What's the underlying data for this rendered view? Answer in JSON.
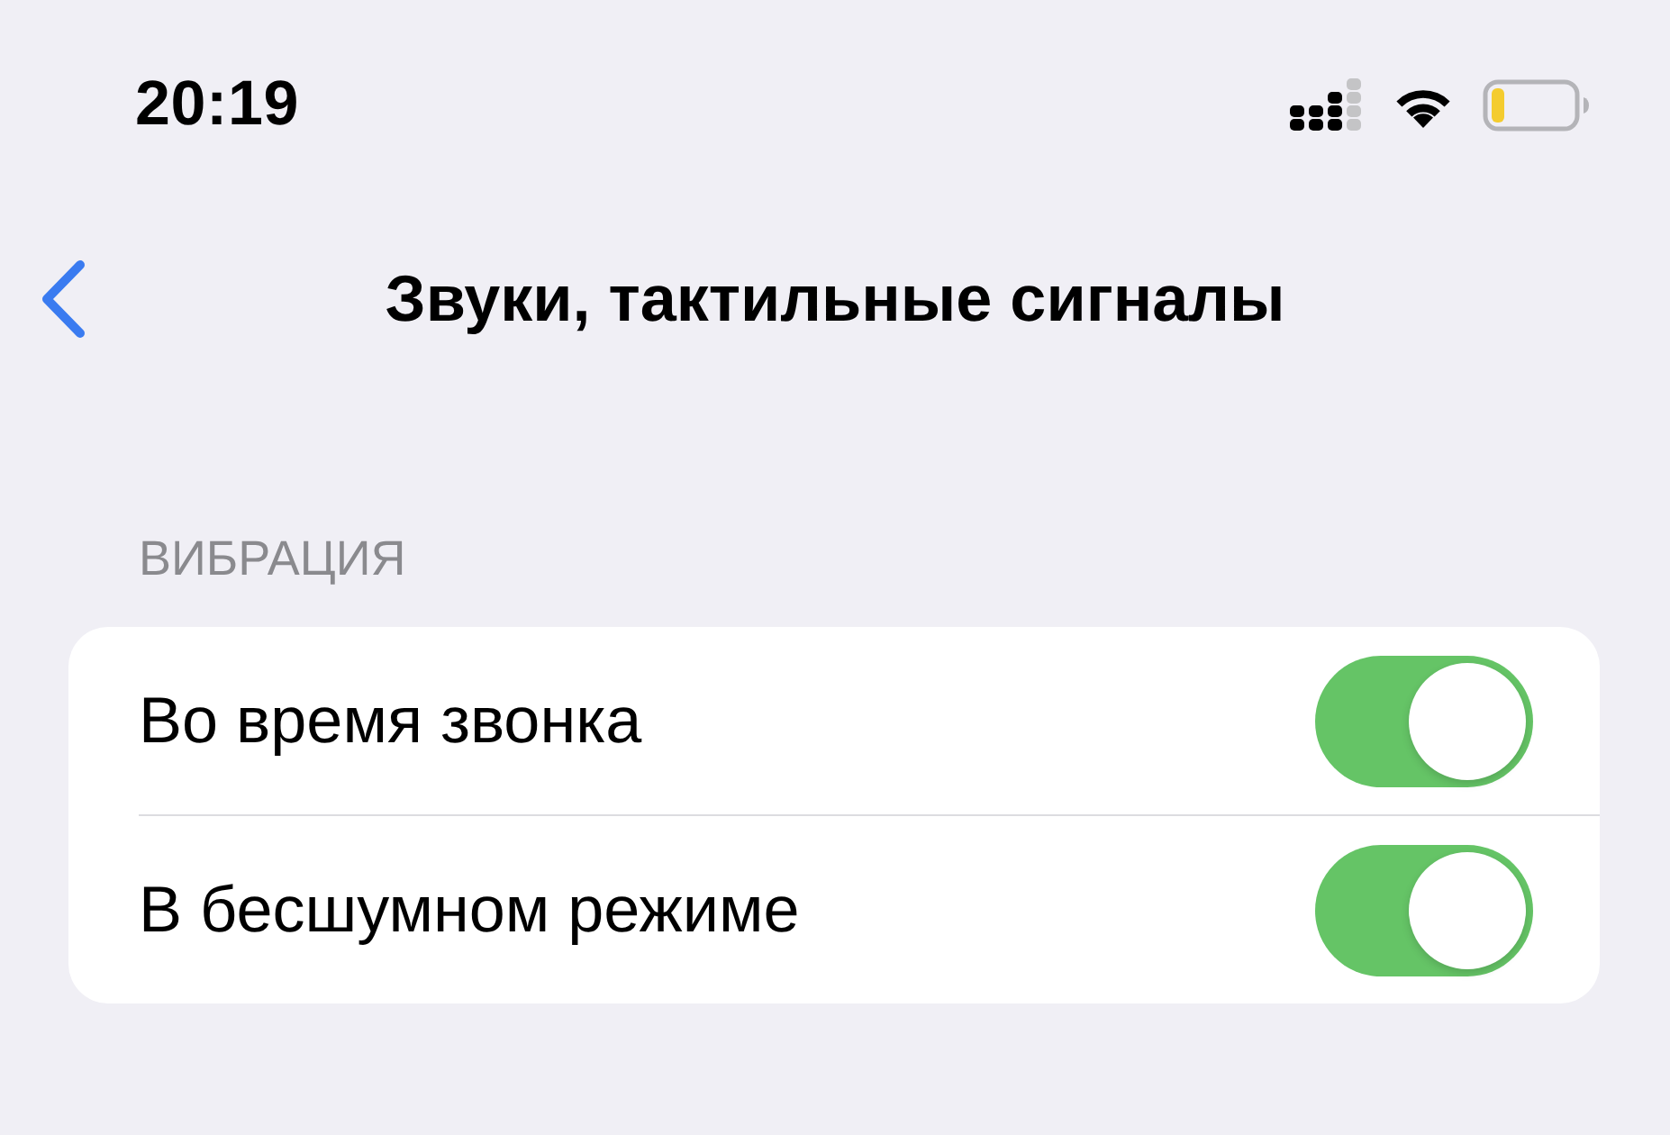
{
  "status_bar": {
    "time": "20:19"
  },
  "nav_bar": {
    "title": "Звуки, тактильные сигналы"
  },
  "sections": [
    {
      "header": "ВИБРАЦИЯ",
      "rows": [
        {
          "label": "Во время звонка",
          "on": true
        },
        {
          "label": "В бесшумном режиме",
          "on": true
        }
      ]
    }
  ]
}
